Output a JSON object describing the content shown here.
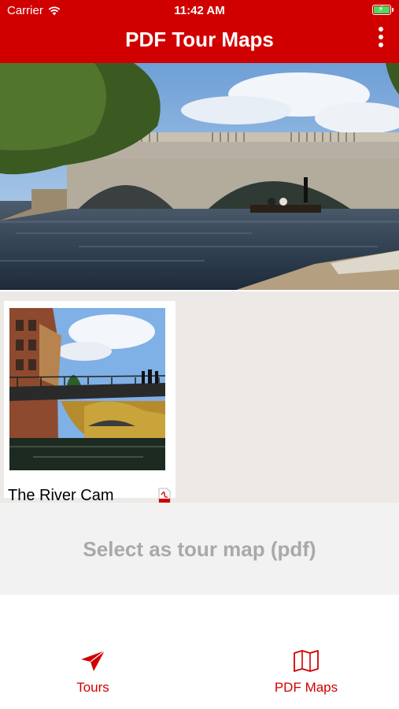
{
  "status": {
    "carrier": "Carrier",
    "time": "11:42 AM",
    "battery_level": 0.9
  },
  "header": {
    "title": "PDF Tour Maps"
  },
  "icons": {
    "wifi": "wifi-icon",
    "battery": "battery-icon",
    "more": "more-vertical-icon",
    "pdf": "pdf-file-icon",
    "tours": "send-arrow-icon",
    "pdf_maps": "map-icon"
  },
  "tour_maps": [
    {
      "title": "The River Cam"
    }
  ],
  "select_button": {
    "label": "Select as tour map (pdf)"
  },
  "tabs": [
    {
      "label": "Tours"
    },
    {
      "label": "PDF Maps"
    }
  ],
  "colors": {
    "brand": "#d10000",
    "disabled_text": "#a9a9a9",
    "grid_bg": "#ece9e6"
  }
}
